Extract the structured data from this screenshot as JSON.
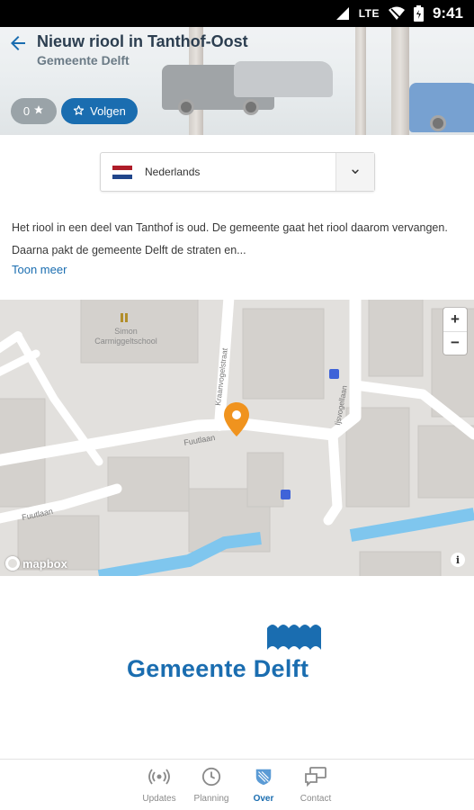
{
  "status_bar": {
    "network": "LTE",
    "time": "9:41"
  },
  "header": {
    "title": "Nieuw riool in Tanthof-Oost",
    "subtitle": "Gemeente Delft",
    "rating_count": "0",
    "follow_label": "Volgen"
  },
  "language_select": {
    "selected": "Nederlands"
  },
  "description": {
    "text": "Het riool in een deel van Tanthof is oud. De gemeente gaat het riool daarom vervangen. Daarna pakt de gemeente Delft de straten en...",
    "more_label": "Toon meer"
  },
  "map": {
    "labels": {
      "school": "Simon Carmiggeltschool",
      "street1": "Kraanvogelstraat",
      "street2": "Fuutlaan",
      "street3": "Fuutlaan",
      "street4": "Ijsvogellaan"
    },
    "zoom_in": "+",
    "zoom_out": "−",
    "attribution": "mapbox",
    "info": "i",
    "pin_color": "#f0931e"
  },
  "org_logo": {
    "text": "Gemeente Delft",
    "color": "#1a6db0"
  },
  "bottom_nav": {
    "items": [
      {
        "label": "Updates"
      },
      {
        "label": "Planning"
      },
      {
        "label": "Over"
      },
      {
        "label": "Contact"
      }
    ],
    "active": "Over"
  }
}
